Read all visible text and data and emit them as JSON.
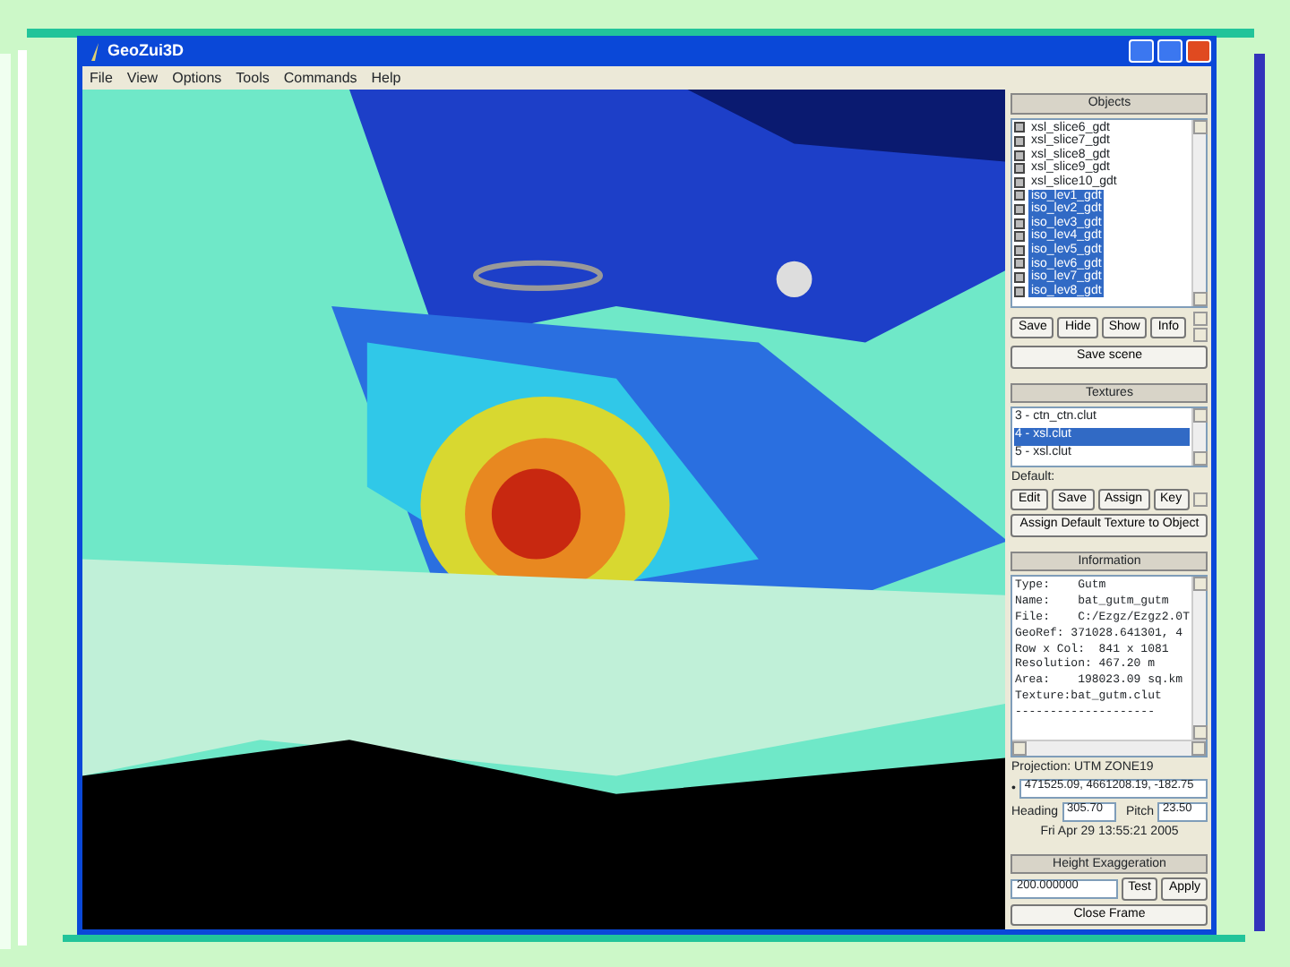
{
  "window": {
    "title": "GeoZui3D"
  },
  "menu": [
    "File",
    "View",
    "Options",
    "Tools",
    "Commands",
    "Help"
  ],
  "objects": {
    "title": "Objects",
    "items": [
      {
        "label": "xsl_slice6_gdt",
        "selected": false
      },
      {
        "label": "xsl_slice7_gdt",
        "selected": false
      },
      {
        "label": "xsl_slice8_gdt",
        "selected": false
      },
      {
        "label": "xsl_slice9_gdt",
        "selected": false
      },
      {
        "label": "xsl_slice10_gdt",
        "selected": false
      },
      {
        "label": "iso_lev1_gdt",
        "selected": true
      },
      {
        "label": "iso_lev2_gdt",
        "selected": true
      },
      {
        "label": "iso_lev3_gdt",
        "selected": true
      },
      {
        "label": "iso_lev4_gdt",
        "selected": true
      },
      {
        "label": "iso_lev5_gdt",
        "selected": true
      },
      {
        "label": "iso_lev6_gdt",
        "selected": true
      },
      {
        "label": "iso_lev7_gdt",
        "selected": true
      },
      {
        "label": "iso_lev8_gdt",
        "selected": true
      }
    ],
    "buttons": [
      "Save",
      "Hide",
      "Show",
      "Info"
    ],
    "save_scene": "Save scene"
  },
  "textures": {
    "title": "Textures",
    "items": [
      {
        "label": "3 - ctn_ctn.clut",
        "selected": false
      },
      {
        "label": "4 - xsl.clut",
        "selected": true
      },
      {
        "label": "5 - xsl.clut",
        "selected": false
      }
    ],
    "default_label": "Default:",
    "buttons": [
      "Edit",
      "Save",
      "Assign",
      "Key"
    ],
    "assign_default": "Assign Default Texture to Object"
  },
  "information": {
    "title": "Information",
    "lines": [
      "Type:    Gutm",
      "Name:    bat_gutm_gutm",
      "File:    C:/Ezgz/Ezgz2.0T",
      "GeoRef: 371028.641301, 4",
      "Row x Col:  841 x 1081",
      "Resolution: 467.20 m",
      "Area:    198023.09 sq.km",
      "Texture:bat_gutm.clut",
      "--------------------"
    ],
    "projection": "Projection:  UTM ZONE19",
    "coordinates_marker": "•",
    "coordinates": "471525.09, 4661208.19, -182.75",
    "heading_label": "Heading",
    "heading": "305.70",
    "pitch_label": "Pitch",
    "pitch": "23.50",
    "datetime": "Fri Apr 29 13:55:21 2005"
  },
  "height_exaggeration": {
    "title": "Height Exaggeration",
    "value": "200.000000",
    "buttons": [
      "Test",
      "Apply"
    ]
  },
  "close_button": "Close Frame"
}
